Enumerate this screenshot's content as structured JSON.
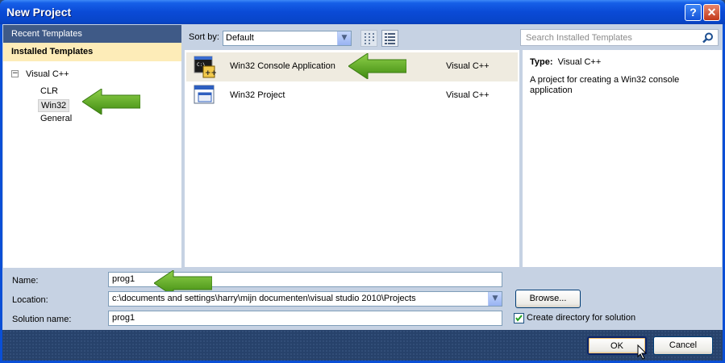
{
  "window": {
    "title": "New Project",
    "help_label": "?",
    "close_label": "✕"
  },
  "left": {
    "recent_templates": "Recent Templates",
    "installed_templates": "Installed Templates",
    "tree": {
      "expander": "−",
      "root": "Visual C++",
      "children": [
        "CLR",
        "Win32",
        "General"
      ],
      "selected": "Win32"
    }
  },
  "toolbar": {
    "sort_label": "Sort by:",
    "sort_value": "Default",
    "search_placeholder": "Search Installed Templates",
    "icons": [
      "list-view-icon",
      "detail-view-icon",
      "search-icon"
    ]
  },
  "templates": [
    {
      "name": "Win32 Console Application",
      "language": "Visual C++",
      "icon": "console-app-icon",
      "selected": true
    },
    {
      "name": "Win32 Project",
      "language": "Visual C++",
      "icon": "win32-project-icon",
      "selected": false
    }
  ],
  "info": {
    "type_label": "Type:",
    "type_value": "Visual C++",
    "description": "A project for creating a Win32 console application"
  },
  "form": {
    "name_label": "Name:",
    "name_value": "prog1",
    "location_label": "Location:",
    "location_value": "c:\\documents and settings\\harry\\mijn documenten\\visual studio 2010\\Projects",
    "solution_label": "Solution name:",
    "solution_value": "prog1",
    "browse_label": "Browse...",
    "create_dir_label": "Create directory for solution",
    "create_dir_checked": true
  },
  "buttons": {
    "ok": "OK",
    "cancel": "Cancel"
  },
  "colors": {
    "arrow": "#5fa720",
    "title_bar": "#0a4ad6",
    "selected_row": "#efebe0",
    "installed_header": "#fdecb8"
  }
}
